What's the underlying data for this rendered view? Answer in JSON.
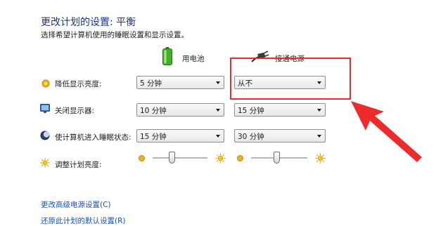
{
  "header": {
    "title": "更改计划的设置: 平衡",
    "subtitle": "选择希望计算机使用的睡眠设置和显示设置。"
  },
  "columns": {
    "battery_label": "用电池",
    "plugged_label": "接通电源"
  },
  "rows": [
    {
      "label": "降低显示亮度:",
      "icon": "dim-display-icon",
      "battery_value": "5 分钟",
      "plugged_value": "从不"
    },
    {
      "label": "关闭显示器:",
      "icon": "monitor-icon",
      "battery_value": "10 分钟",
      "plugged_value": "15 分钟"
    },
    {
      "label": "使计算机进入睡眠状态:",
      "icon": "sleep-moon-icon",
      "battery_value": "15 分钟",
      "plugged_value": "30 分钟"
    }
  ],
  "brightness": {
    "label": "调整计划亮度:",
    "icon": "sun-icon",
    "battery_level": 0.35,
    "plugged_level": 0.45
  },
  "links": {
    "advanced": "更改高级电源设置(C)",
    "restore": "还原此计划的默认设置(R)"
  },
  "annotation": {
    "color": "#ee2a2a"
  }
}
